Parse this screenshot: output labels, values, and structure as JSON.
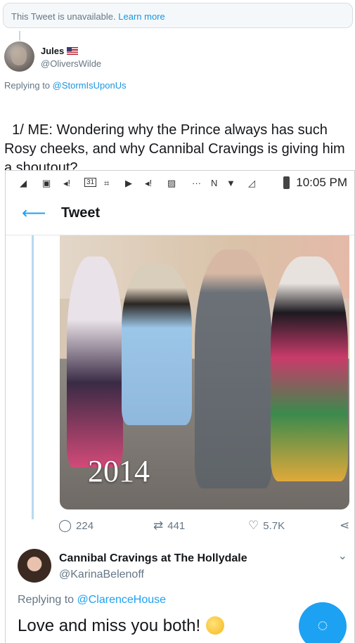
{
  "banner": {
    "text": "This Tweet is unavailable.",
    "link": "Learn more"
  },
  "tweet": {
    "author_name": "Jules",
    "author_handle": "@OliversWilde",
    "replying_label": "Replying to",
    "replying_to": "@StormIsUponUs",
    "text": "1/ ME: Wondering why the Prince always has such Rosy cheeks, and why Cannibal Cravings is giving him a shoutout?"
  },
  "phone": {
    "status_time": "10:05 PM",
    "status_icons": [
      "media-icon",
      "message-icon",
      "calendar-icon",
      "network-icon",
      "nfc-icon",
      "wifi-icon",
      "signal-icon",
      "battery-icon"
    ],
    "calendar_day": "31",
    "appbar_title": "Tweet",
    "photo_caption": "2014",
    "actions": {
      "replies": "224",
      "retweets": "441",
      "likes": "5.7K"
    },
    "reply": {
      "author_name": "Cannibal Cravings at The Hollydale",
      "author_handle": "@KarinaBelenoff",
      "replying_label": "Replying to",
      "replying_to": "@ClarenceHouse",
      "text": "Love and miss you both!"
    }
  },
  "colors": {
    "link_blue": "#1b95e0",
    "twitter_blue": "#1da1f2",
    "muted": "#657786"
  }
}
